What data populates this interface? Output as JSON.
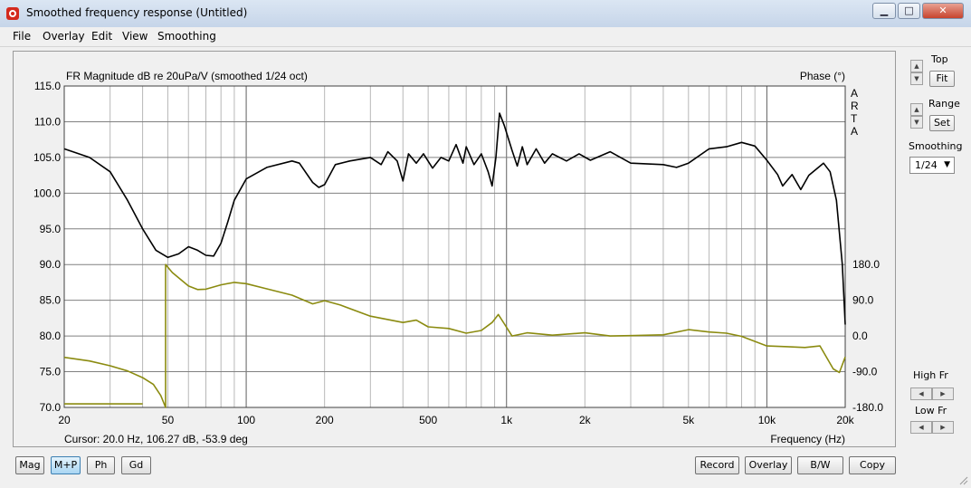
{
  "window": {
    "title": "Smoothed frequency response (Untitled)"
  },
  "menu": [
    "File",
    "Overlay",
    "Edit",
    "View",
    "Smoothing"
  ],
  "plot": {
    "title": "FR Magnitude dB re 20uPa/V (smoothed 1/24 oct)",
    "phase_title": "Phase (°)",
    "watermark": [
      "A",
      "R",
      "T",
      "A"
    ],
    "cursor_text": "Cursor: 20.0 Hz, 106.27 dB, -53.9 deg",
    "xlabel": "Frequency (Hz)"
  },
  "chart_data": {
    "type": "line",
    "x_scale": "log",
    "xlim": [
      20,
      20000
    ],
    "ylim": [
      70,
      115
    ],
    "y2lim": [
      -180,
      180
    ],
    "x_tick_labels": [
      "20",
      "50",
      "100",
      "200",
      "500",
      "1k",
      "2k",
      "5k",
      "10k",
      "20k"
    ],
    "x_tick_values": [
      20,
      50,
      100,
      200,
      500,
      1000,
      2000,
      5000,
      10000,
      20000
    ],
    "y_tick_labels": [
      "115.0",
      "110.0",
      "105.0",
      "100.0",
      "95.0",
      "90.0",
      "85.0",
      "80.0",
      "75.0",
      "70.0"
    ],
    "y_tick_values": [
      115,
      110,
      105,
      100,
      95,
      90,
      85,
      80,
      75,
      70
    ],
    "y2_tick_labels": [
      "180.0",
      "90.0",
      "0.0",
      "-90.0",
      "-180.0"
    ],
    "y2_tick_values": [
      180,
      90,
      0,
      -90,
      -180
    ],
    "grid": true,
    "series": [
      {
        "color": "#000000",
        "axis": "y",
        "points": [
          [
            20,
            106.2
          ],
          [
            25,
            105
          ],
          [
            30,
            103
          ],
          [
            35,
            99
          ],
          [
            40,
            95
          ],
          [
            45,
            92
          ],
          [
            50,
            91
          ],
          [
            55,
            91.5
          ],
          [
            60,
            92.5
          ],
          [
            65,
            92
          ],
          [
            70,
            91.3
          ],
          [
            75,
            91.2
          ],
          [
            80,
            93
          ],
          [
            85,
            96
          ],
          [
            90,
            99
          ],
          [
            100,
            102
          ],
          [
            120,
            103.6
          ],
          [
            150,
            104.5
          ],
          [
            160,
            104.2
          ],
          [
            180,
            101.5
          ],
          [
            190,
            100.8
          ],
          [
            200,
            101.2
          ],
          [
            220,
            104
          ],
          [
            250,
            104.5
          ],
          [
            300,
            105
          ],
          [
            330,
            104
          ],
          [
            350,
            105.8
          ],
          [
            380,
            104.5
          ],
          [
            400,
            101.7
          ],
          [
            420,
            105.5
          ],
          [
            450,
            104.2
          ],
          [
            480,
            105.5
          ],
          [
            520,
            103.5
          ],
          [
            560,
            105
          ],
          [
            600,
            104.5
          ],
          [
            640,
            106.8
          ],
          [
            680,
            104.2
          ],
          [
            700,
            106.5
          ],
          [
            750,
            104
          ],
          [
            800,
            105.5
          ],
          [
            850,
            103
          ],
          [
            880,
            101
          ],
          [
            910,
            105
          ],
          [
            940,
            111.2
          ],
          [
            980,
            109.5
          ],
          [
            1050,
            106
          ],
          [
            1100,
            103.8
          ],
          [
            1150,
            106.5
          ],
          [
            1200,
            104
          ],
          [
            1300,
            106.2
          ],
          [
            1400,
            104.2
          ],
          [
            1500,
            105.5
          ],
          [
            1700,
            104.5
          ],
          [
            1900,
            105.5
          ],
          [
            2100,
            104.6
          ],
          [
            2500,
            105.8
          ],
          [
            3000,
            104.2
          ],
          [
            4000,
            104
          ],
          [
            4500,
            103.6
          ],
          [
            5000,
            104.2
          ],
          [
            6000,
            106.2
          ],
          [
            7000,
            106.5
          ],
          [
            8000,
            107.1
          ],
          [
            9000,
            106.6
          ],
          [
            10000,
            104.6
          ],
          [
            11000,
            102.6
          ],
          [
            11500,
            101
          ],
          [
            12500,
            102.6
          ],
          [
            13500,
            100.5
          ],
          [
            14500,
            102.5
          ],
          [
            16500,
            104.2
          ],
          [
            17500,
            103
          ],
          [
            18500,
            99
          ],
          [
            19500,
            90
          ],
          [
            20000,
            81.6
          ]
        ]
      },
      {
        "color": "#8b8b10",
        "axis": "y2",
        "points": [
          [
            20,
            -53.9
          ],
          [
            25,
            -63
          ],
          [
            30,
            -75
          ],
          [
            35,
            -88
          ],
          [
            40,
            -105
          ],
          [
            44,
            -122
          ],
          [
            47,
            -150
          ],
          [
            49,
            -180
          ],
          [
            49,
            180
          ],
          [
            52,
            160
          ],
          [
            60,
            126
          ],
          [
            65,
            117
          ],
          [
            70,
            118
          ],
          [
            80,
            129
          ],
          [
            90,
            135
          ],
          [
            100,
            132
          ],
          [
            120,
            119
          ],
          [
            150,
            103
          ],
          [
            180,
            81
          ],
          [
            200,
            89
          ],
          [
            230,
            78
          ],
          [
            300,
            50
          ],
          [
            400,
            34
          ],
          [
            450,
            40
          ],
          [
            500,
            23
          ],
          [
            600,
            19
          ],
          [
            700,
            7
          ],
          [
            800,
            14
          ],
          [
            880,
            34
          ],
          [
            930,
            54
          ],
          [
            980,
            31
          ],
          [
            1050,
            0
          ],
          [
            1200,
            8
          ],
          [
            1500,
            2
          ],
          [
            2000,
            8
          ],
          [
            2500,
            0
          ],
          [
            3000,
            1
          ],
          [
            4000,
            3
          ],
          [
            5000,
            16
          ],
          [
            6000,
            10
          ],
          [
            7000,
            7
          ],
          [
            8000,
            -1
          ],
          [
            10000,
            -25
          ],
          [
            12000,
            -27
          ],
          [
            14000,
            -29
          ],
          [
            16000,
            -25
          ],
          [
            18000,
            -83
          ],
          [
            19000,
            -92
          ],
          [
            20000,
            -53
          ]
        ]
      },
      {
        "color": "#8b8b10",
        "axis": "y2",
        "points": [
          [
            20,
            -171
          ],
          [
            40,
            -171
          ]
        ]
      }
    ]
  },
  "side": {
    "top_label": "Top",
    "fit_label": "Fit",
    "range_label": "Range",
    "set_label": "Set",
    "smoothing_label": "Smoothing",
    "smoothing_value": "1/24",
    "highfr_label": "High Fr",
    "lowfr_label": "Low Fr"
  },
  "bottom": {
    "mag": "Mag",
    "mp": "M+P",
    "ph": "Ph",
    "gd": "Gd",
    "record": "Record",
    "overlay": "Overlay",
    "bw": "B/W",
    "copy": "Copy"
  }
}
